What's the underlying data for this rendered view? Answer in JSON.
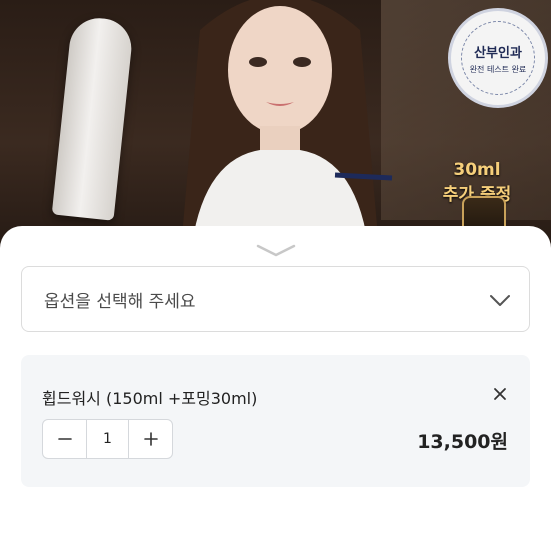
{
  "banner": {
    "badge_title": "산부인과",
    "badge_subtitle": "완전 테스트 완료",
    "promo_line1": "30ml",
    "promo_line2": "추가 증정"
  },
  "option_select": {
    "placeholder": "옵션을 선택해 주세요"
  },
  "selected_option": {
    "name": "휩드워시 (150ml +포밍30ml)",
    "quantity": "1",
    "price": "13,500원"
  },
  "icons": {
    "sheet_handle": "chevron-down-icon",
    "select_chevron": "chevron-down-icon",
    "remove": "close-icon",
    "decrement": "minus-icon",
    "increment": "plus-icon"
  },
  "colors": {
    "promo_gold": "#f6cf7b",
    "badge_navy": "#1f2a55",
    "card_bg": "#f4f6f8"
  }
}
